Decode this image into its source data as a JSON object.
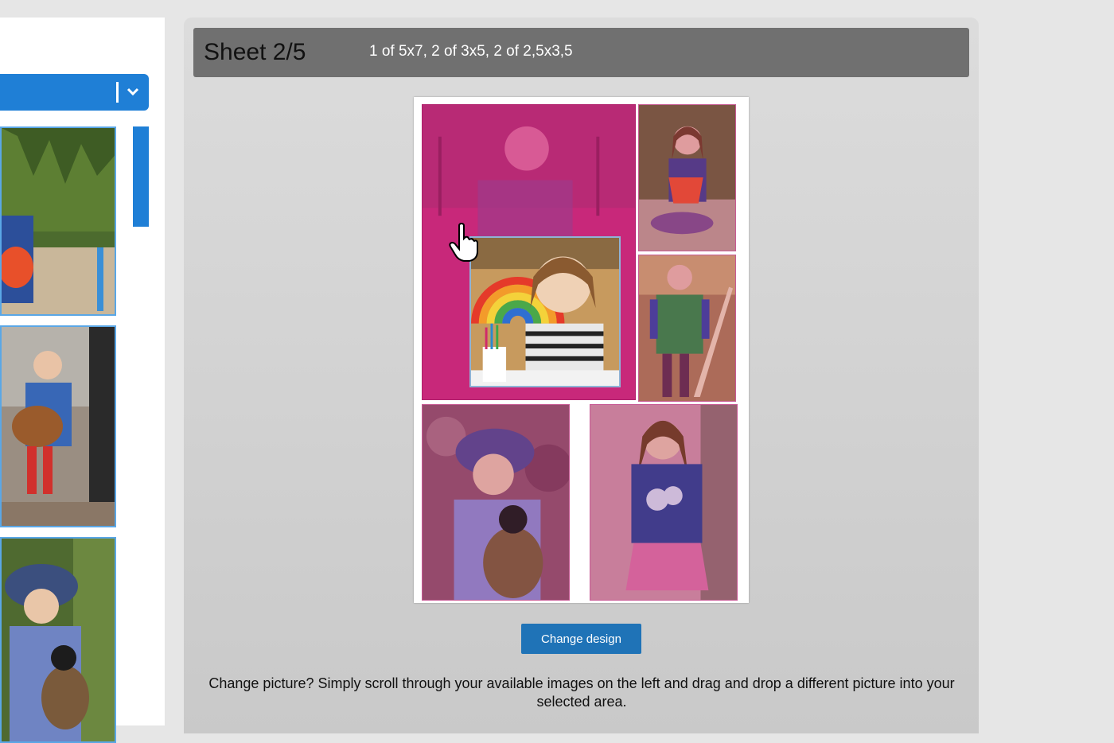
{
  "sheet": {
    "title": "Sheet 2/5",
    "description": "1 of 5x7, 2 of 3x5, 2 of 2,5x3,5"
  },
  "buttons": {
    "change_design": "Change design"
  },
  "help_text": "Change picture? Simply scroll through your available images on the left and drag and drop a different picture into your selected area.",
  "icons": {
    "dropdown": "chevron-down-icon",
    "cursor": "hand-pointer-icon"
  },
  "colors": {
    "accent": "#1f7fd6",
    "button": "#1f73b7",
    "header": "#707070",
    "selection_tint": "#c8287a"
  }
}
